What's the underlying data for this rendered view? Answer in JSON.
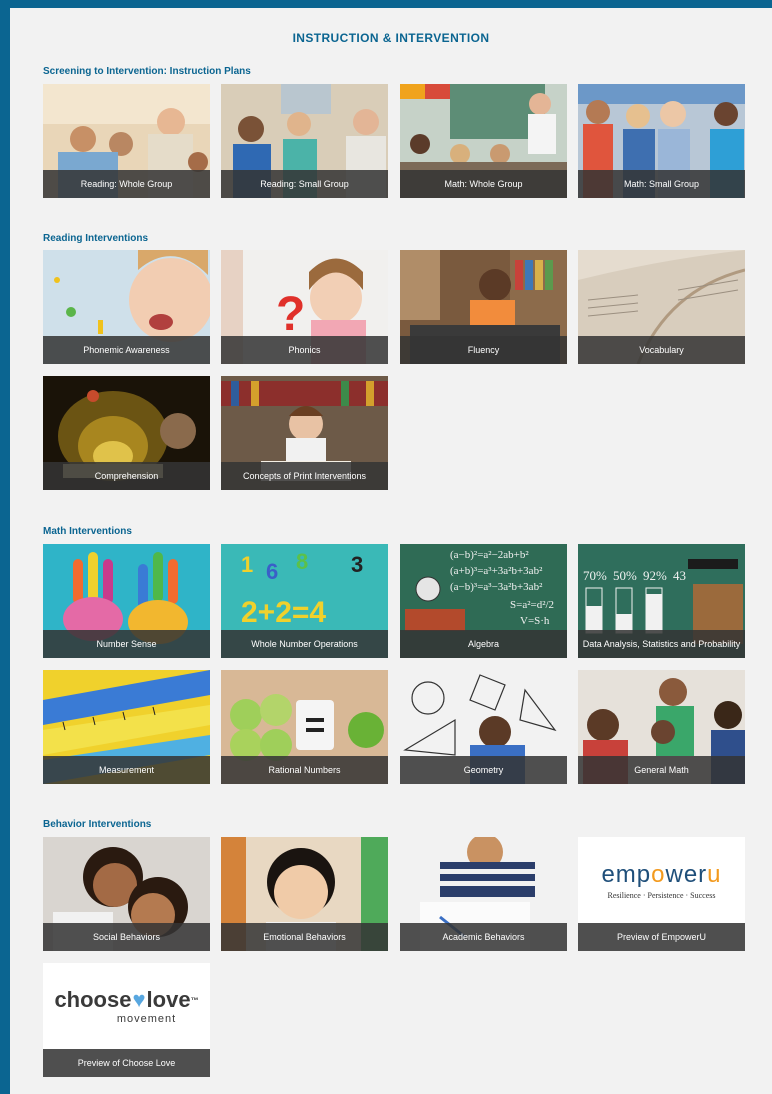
{
  "page_title": "INSTRUCTION & INTERVENTION",
  "sections": [
    {
      "title": "Screening to Intervention: Instruction Plans",
      "tiles": [
        {
          "label": "Reading: Whole Group",
          "icon": "classroom-photo"
        },
        {
          "label": "Reading: Small Group",
          "icon": "classroom-photo"
        },
        {
          "label": "Math: Whole Group",
          "icon": "classroom-photo"
        },
        {
          "label": "Math: Small Group",
          "icon": "classroom-photo"
        }
      ]
    },
    {
      "title": "Reading Interventions",
      "tiles": [
        {
          "label": "Phonemic Awareness",
          "icon": "child-photo"
        },
        {
          "label": "Phonics",
          "icon": "child-photo"
        },
        {
          "label": "Fluency",
          "icon": "child-reading-photo"
        },
        {
          "label": "Vocabulary",
          "icon": "dictionary-photo"
        },
        {
          "label": "Comprehension",
          "icon": "glowing-book-photo"
        },
        {
          "label": "Concepts of Print Interventions",
          "icon": "library-photo"
        }
      ]
    },
    {
      "title": "Math Interventions",
      "tiles": [
        {
          "label": "Number Sense",
          "icon": "painted-hands-photo"
        },
        {
          "label": "Whole Number Operations",
          "icon": "number-blocks-photo"
        },
        {
          "label": "Algebra",
          "icon": "chalkboard-photo"
        },
        {
          "label": "Data Analysis, Statistics and Probability",
          "icon": "chalkboard-photo"
        },
        {
          "label": "Measurement",
          "icon": "tape-measure-photo"
        },
        {
          "label": "Rational Numbers",
          "icon": "apples-photo"
        },
        {
          "label": "Geometry",
          "icon": "shapes-photo"
        },
        {
          "label": "General Math",
          "icon": "classroom-photo"
        }
      ]
    },
    {
      "title": "Behavior Interventions",
      "tiles": [
        {
          "label": "Social Behaviors",
          "icon": "children-photo"
        },
        {
          "label": "Emotional Behaviors",
          "icon": "child-photo"
        },
        {
          "label": "Academic Behaviors",
          "icon": "child-writing-photo"
        },
        {
          "label": "Preview of EmpowerU",
          "icon": "empoweru-logo"
        },
        {
          "label": "Preview of Choose Love",
          "icon": "choose-love-logo"
        }
      ]
    }
  ],
  "empoweru_logo": {
    "name_main": "emp",
    "name_o": "o",
    "name_wer": "wer",
    "name_u": "u",
    "tagline": "Resilience · Persistence · Success"
  },
  "chooselove_logo": {
    "word1": "choose",
    "heart": "♥",
    "word2": "love",
    "tm": "™",
    "sub": "movement"
  },
  "colors": {
    "brand_blue": "#0b6591",
    "caption_bg": "#343434",
    "empoweru_orange": "#f39a1e"
  }
}
